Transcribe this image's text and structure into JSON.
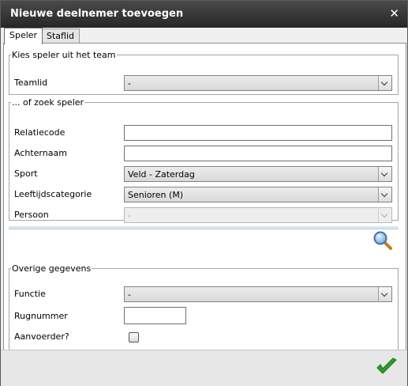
{
  "window": {
    "title": "Nieuwe deelnemer toevoegen"
  },
  "tabs": [
    {
      "label": "Speler",
      "active": true
    },
    {
      "label": "Staflid",
      "active": false
    }
  ],
  "team_section": {
    "legend": "Kies speler uit het team",
    "teamlid": {
      "label": "Teamlid",
      "value": "-"
    }
  },
  "search_section": {
    "legend": "... of zoek speler",
    "relatiecode": {
      "label": "Relatiecode",
      "value": ""
    },
    "achternaam": {
      "label": "Achternaam",
      "value": ""
    },
    "sport": {
      "label": "Sport",
      "value": "Veld - Zaterdag"
    },
    "leeftijdscategorie": {
      "label": "Leeftijdscategorie",
      "value": "Senioren (M)"
    },
    "persoon": {
      "label": "Persoon",
      "value": "-",
      "disabled": true
    },
    "search_icon": "magnifier-icon"
  },
  "other_section": {
    "legend": "Overige gegevens",
    "functie": {
      "label": "Functie",
      "value": "-"
    },
    "rugnummer": {
      "label": "Rugnummer",
      "value": ""
    },
    "aanvoerder": {
      "label": "Aanvoerder?",
      "checked": false
    }
  },
  "footer": {
    "ok_icon": "checkmark-icon"
  },
  "colors": {
    "titlebar": "#262626",
    "ok_green": "#2aa02a"
  }
}
